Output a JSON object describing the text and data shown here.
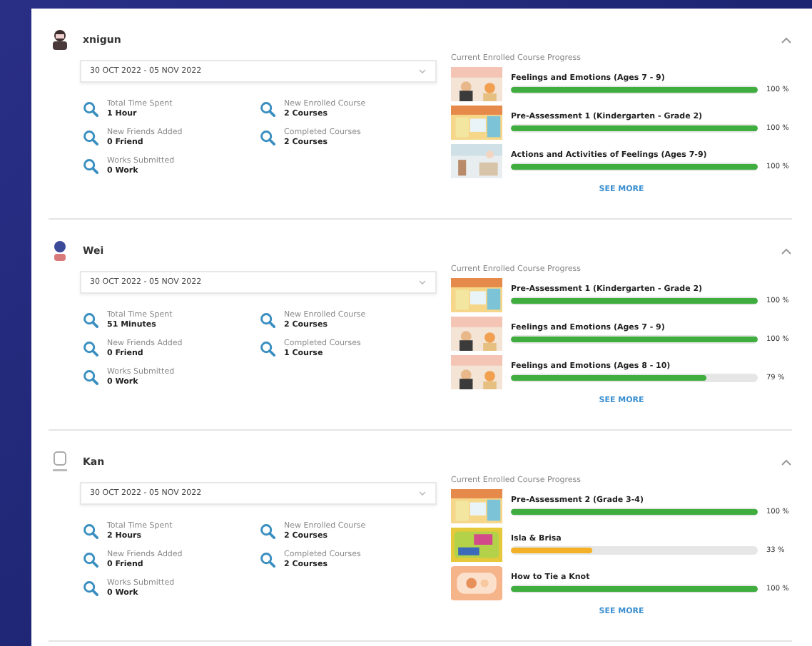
{
  "students": [
    {
      "name": "xnigun",
      "expanded": true,
      "date_range": "30 OCT 2022 - 05 NOV 2022",
      "stats": [
        {
          "label": "Total Time Spent",
          "value": "1 Hour"
        },
        {
          "label": "New Enrolled Course",
          "value": "2 Courses"
        },
        {
          "label": "New Friends Added",
          "value": "0 Friend"
        },
        {
          "label": "Completed Courses",
          "value": "2 Courses"
        },
        {
          "label": "Works Submitted",
          "value": "0 Work"
        }
      ],
      "progress_title": "Current Enrolled Course Progress",
      "courses": [
        {
          "title": "Feelings and Emotions (Ages 7 - 9)",
          "level": 1,
          "reading": "100 %"
        },
        {
          "title": "Pre-Assessment 1 (Kindergarten - Grade 2)",
          "level": 1,
          "reading": "100 %"
        },
        {
          "title": "Actions and Activities of Feelings (Ages 7-9)",
          "level": 1,
          "reading": "100 %"
        }
      ],
      "see_more": "SEE MORE"
    },
    {
      "name": "Wei",
      "expanded": true,
      "date_range": "30 OCT 2022 - 05 NOV 2022",
      "stats": [
        {
          "label": "Total Time Spent",
          "value": "51 Minutes"
        },
        {
          "label": "New Enrolled Course",
          "value": "2 Courses"
        },
        {
          "label": "New Friends Added",
          "value": "0 Friend"
        },
        {
          "label": "Completed Courses",
          "value": "1 Course"
        },
        {
          "label": "Works Submitted",
          "value": "0 Work"
        }
      ],
      "progress_title": "Current Enrolled Course Progress",
      "courses": [
        {
          "title": "Pre-Assessment 1 (Kindergarten - Grade 2)",
          "level": 1,
          "reading": "100 %"
        },
        {
          "title": "Feelings and Emotions (Ages 7 - 9)",
          "level": 1,
          "reading": "100 %"
        },
        {
          "title": "Feelings and Emotions (Ages 8 - 10)",
          "level": 0.79,
          "reading": "79 %"
        }
      ],
      "see_more": "SEE MORE"
    },
    {
      "name": "Kan",
      "expanded": true,
      "date_range": "30 OCT 2022 - 05 NOV 2022",
      "stats": [
        {
          "label": "Total Time Spent",
          "value": "2 Hours"
        },
        {
          "label": "New Enrolled Course",
          "value": "2 Courses"
        },
        {
          "label": "New Friends Added",
          "value": "0 Friend"
        },
        {
          "label": "Completed Courses",
          "value": "2 Courses"
        },
        {
          "label": "Works Submitted",
          "value": "0 Work"
        }
      ],
      "progress_title": "Current Enrolled Course Progress",
      "courses": [
        {
          "title": "Pre-Assessment 2 (Grade 3-4)",
          "level": 1,
          "reading": "100 %"
        },
        {
          "title": "Isla & Brisa",
          "level": 0.33,
          "reading": "33 %"
        },
        {
          "title": "How to Tie a Knot",
          "level": 1,
          "reading": "100 %"
        }
      ],
      "see_more": "SEE MORE"
    }
  ]
}
